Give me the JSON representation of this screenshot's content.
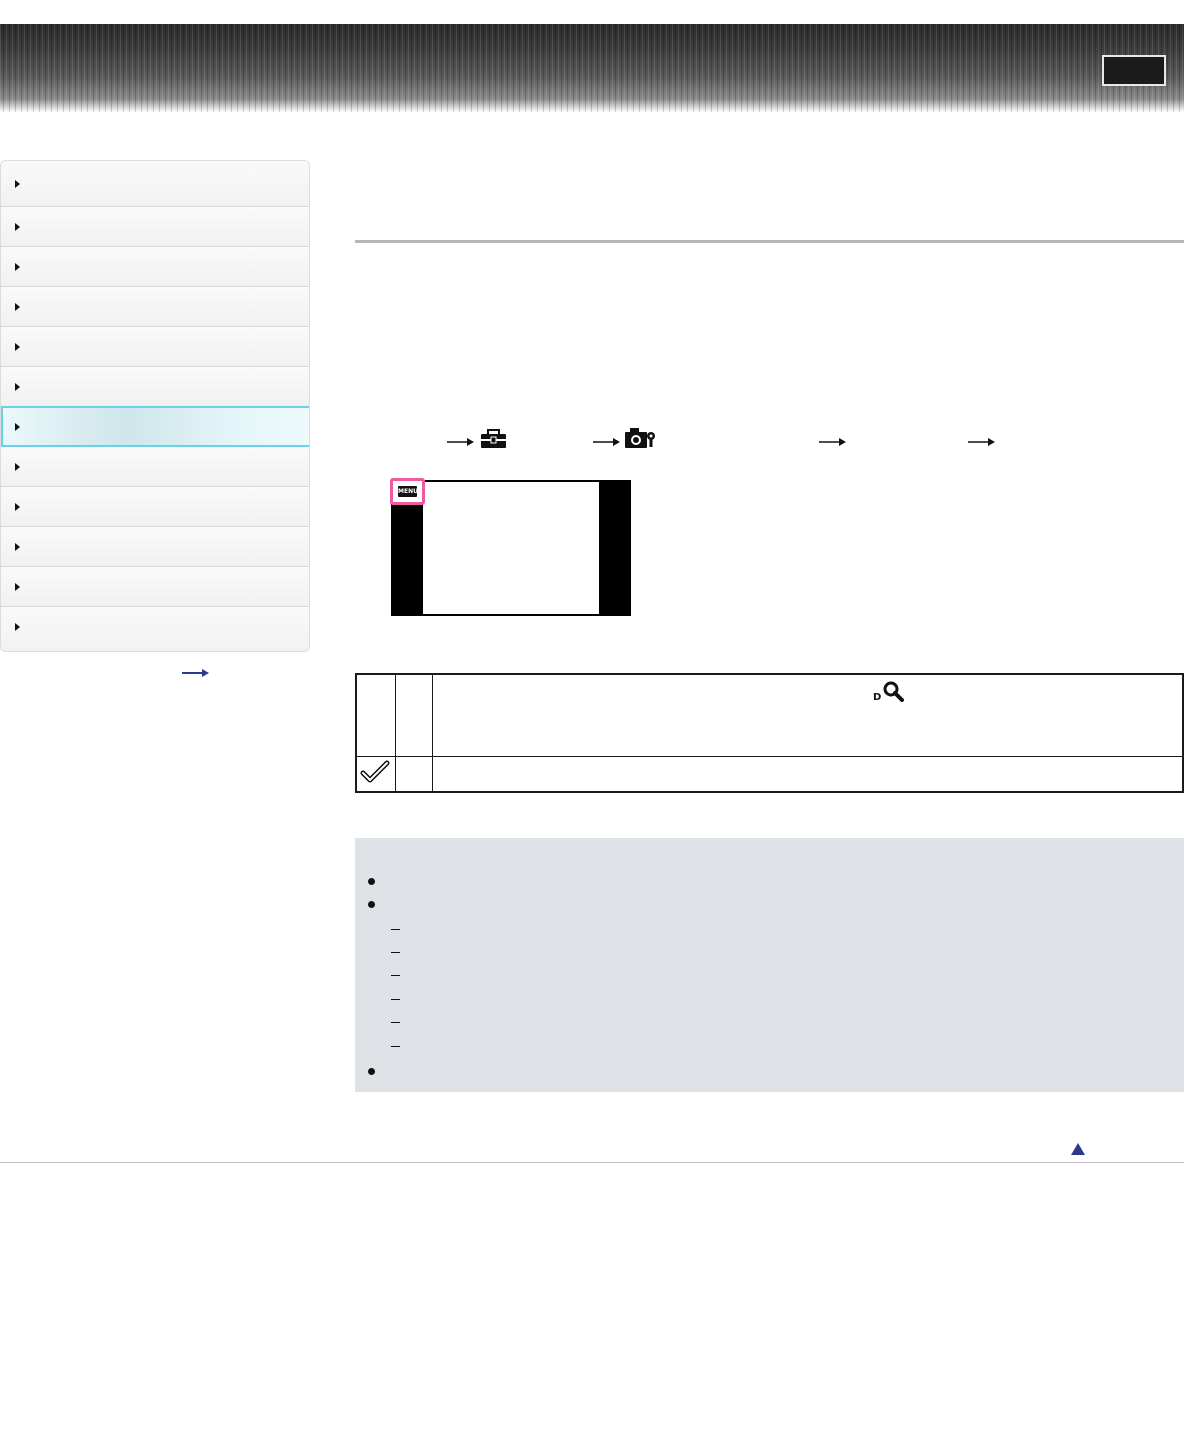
{
  "header": {
    "button_label": ""
  },
  "sidebar": {
    "items": [
      {
        "label": ""
      },
      {
        "label": ""
      },
      {
        "label": ""
      },
      {
        "label": ""
      },
      {
        "label": ""
      },
      {
        "label": ""
      },
      {
        "label": "",
        "active": true
      },
      {
        "label": ""
      },
      {
        "label": ""
      },
      {
        "label": ""
      },
      {
        "label": ""
      },
      {
        "label": ""
      }
    ],
    "more_link": ""
  },
  "main": {
    "title": "",
    "menu_path": [
      {
        "icon": "toolbox-icon"
      },
      {
        "icon": "camera-settings-icon"
      },
      {
        "icon": "arrow-right-icon"
      },
      {
        "icon": "arrow-right-icon"
      }
    ],
    "screen_diagram": {
      "menu_button_label": "MENU"
    },
    "options_table": {
      "rows": [
        {
          "icon": "digital-zoom-icon",
          "label": "",
          "description": ""
        },
        {
          "icon": "check-icon",
          "label": "",
          "description": ""
        }
      ]
    },
    "notes": {
      "bullets": 3,
      "sub_items": 6
    }
  },
  "footer": {
    "top_link_icon": "triangle-up-icon"
  },
  "colors": {
    "accent": "#6ad2e8",
    "highlight": "#ee5aa0",
    "notes_bg": "#dfe2e7",
    "link": "#2b3a8f"
  }
}
